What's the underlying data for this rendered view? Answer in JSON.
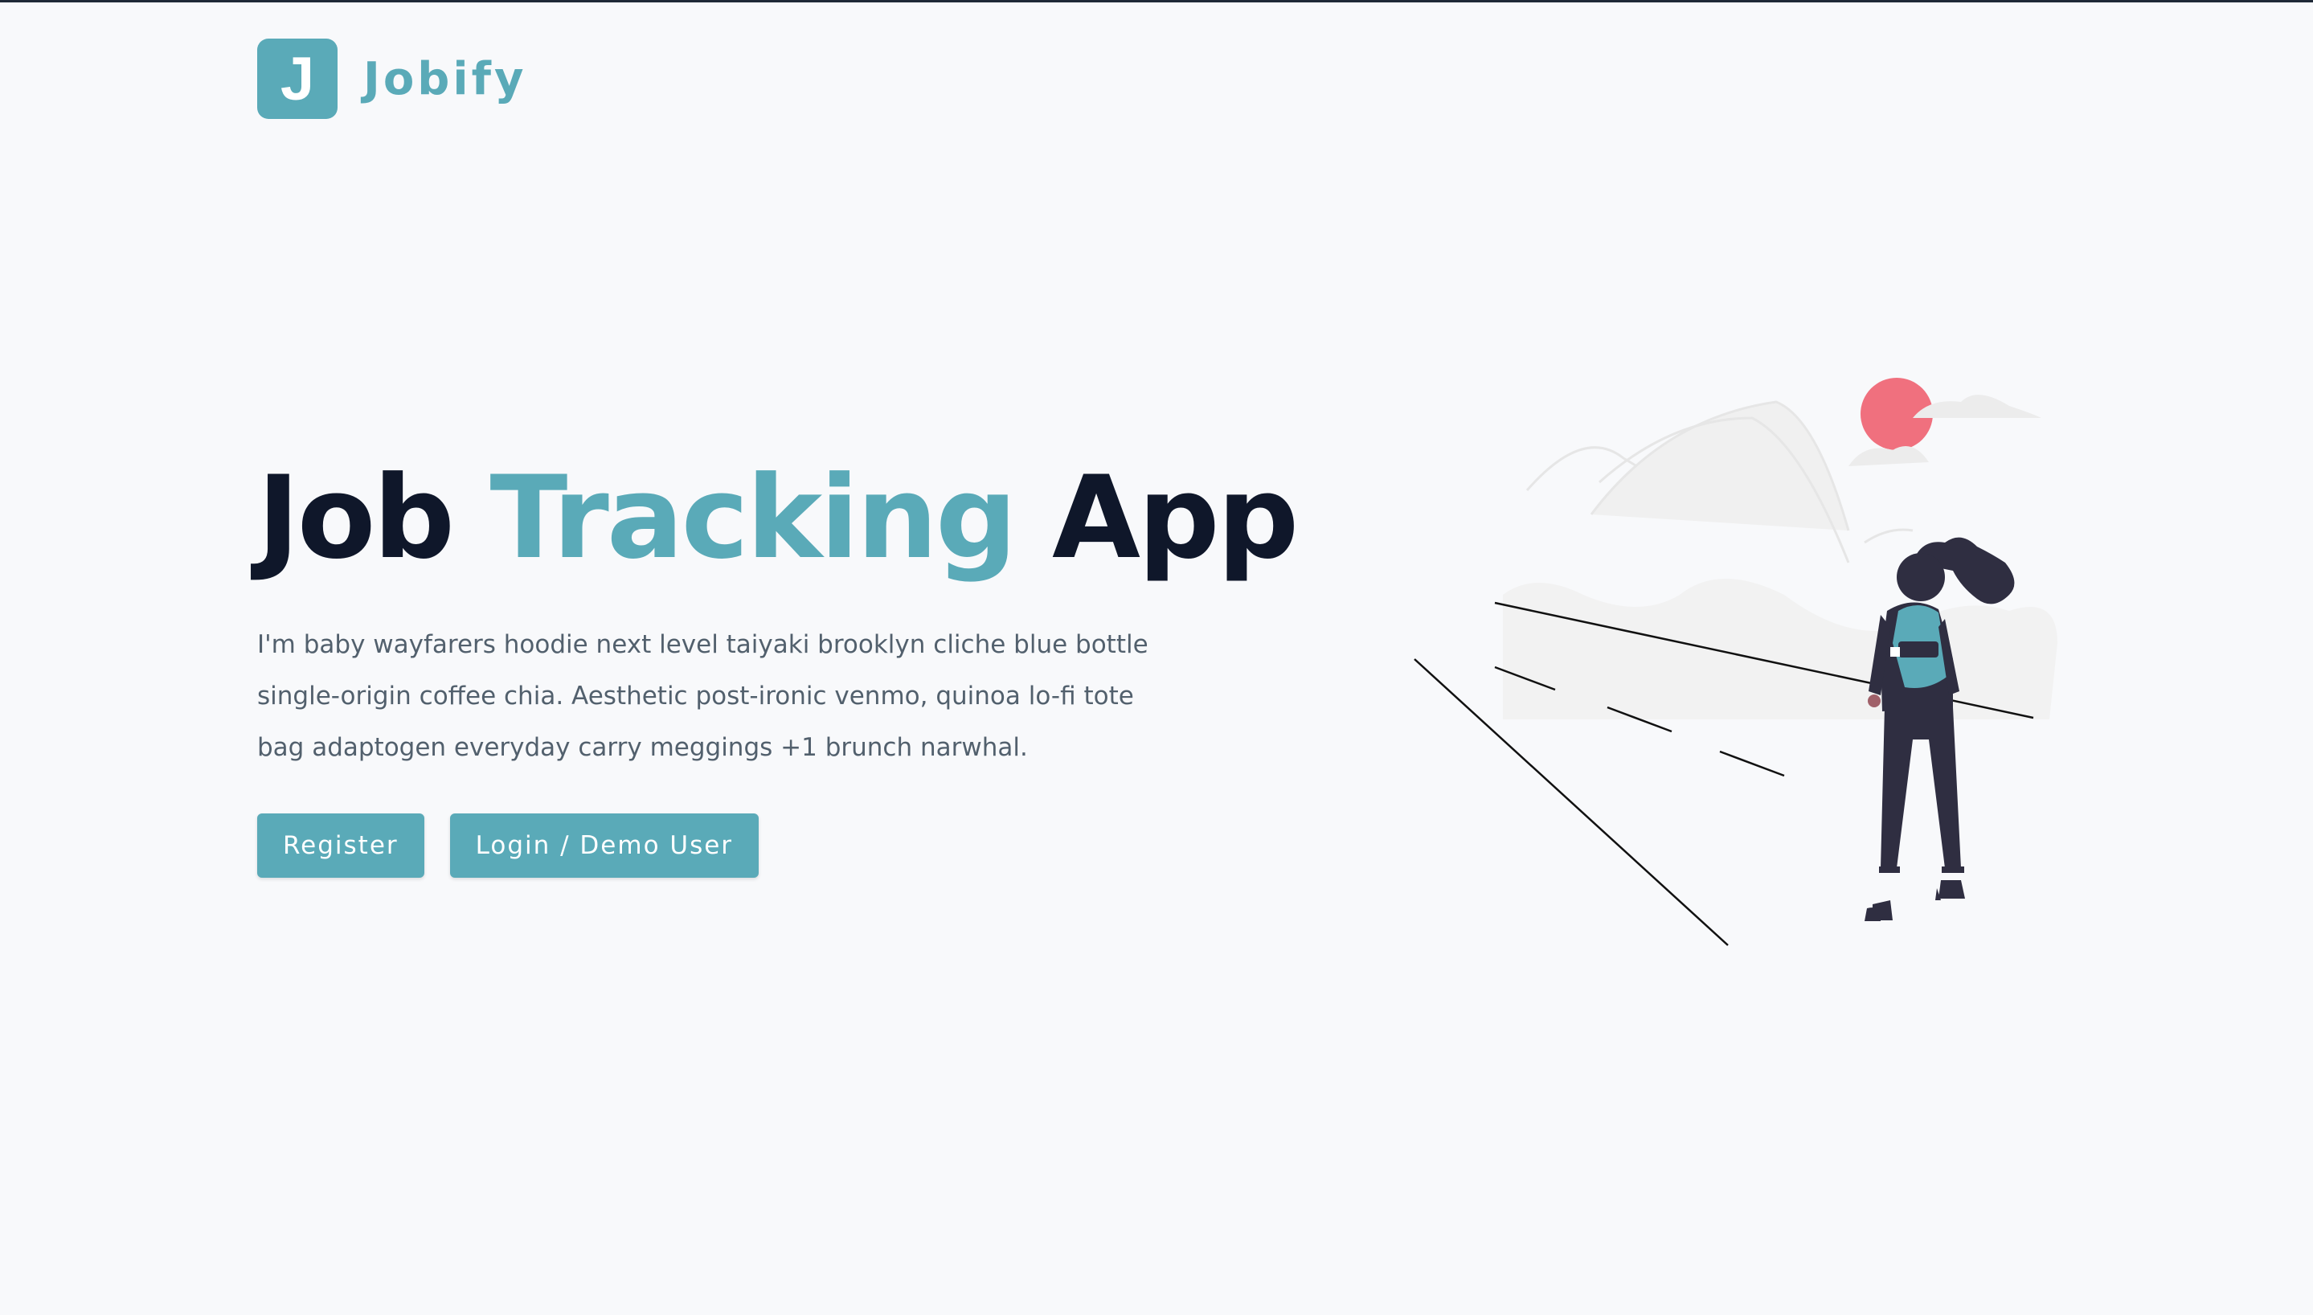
{
  "brand": {
    "logo_letter": "J",
    "name": "Jobify",
    "color": "#5aaab8"
  },
  "hero": {
    "title_part1": "Job",
    "title_accent": "Tracking",
    "title_part2": "App",
    "description": "I'm baby wayfarers hoodie next level taiyaki brooklyn cliche blue bottle single-origin coffee chia. Aesthetic post-ironic venmo, quinoa lo-fi tote bag adaptogen everyday carry meggings +1 brunch narwhal."
  },
  "buttons": {
    "register_label": "Register",
    "login_label": "Login / Demo User"
  },
  "illustration": {
    "subject": "woman-with-backpack-on-road-illustration",
    "accent_color": "#5aaab8",
    "sun_color": "#f0707e",
    "figure_color": "#2f2e41"
  }
}
